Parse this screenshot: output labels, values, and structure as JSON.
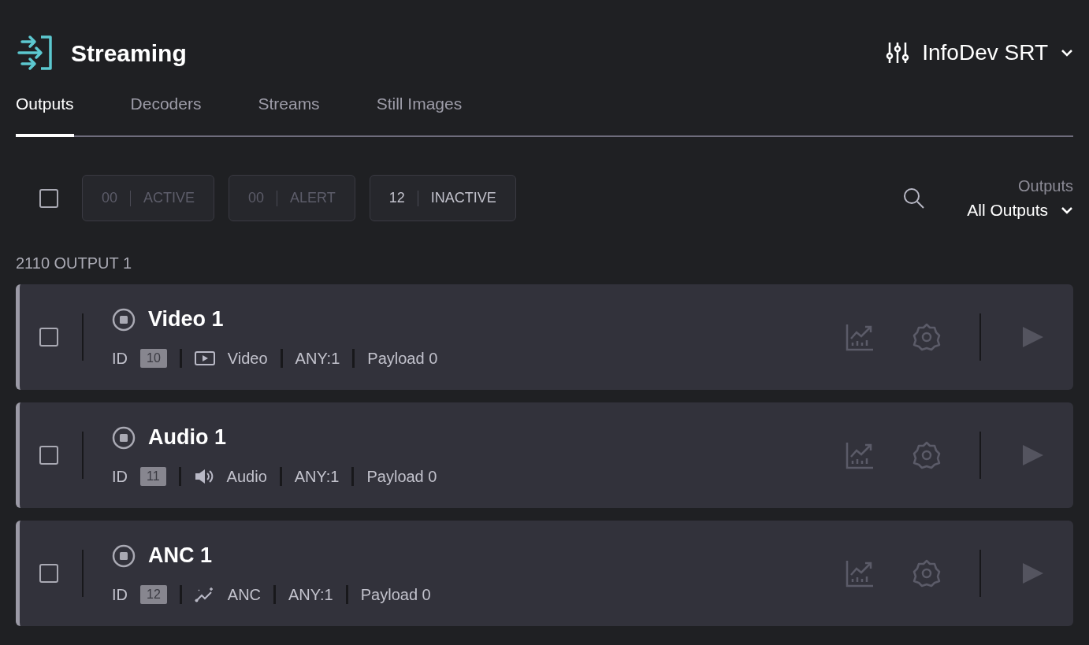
{
  "header": {
    "title": "Streaming",
    "device": "InfoDev SRT"
  },
  "tabs": [
    {
      "label": "Outputs",
      "selected": true
    },
    {
      "label": "Decoders",
      "selected": false
    },
    {
      "label": "Streams",
      "selected": false
    },
    {
      "label": "Still Images",
      "selected": false
    }
  ],
  "select_all": {
    "checked": false
  },
  "filters": [
    {
      "count": "00",
      "label": "ACTIVE",
      "disabled": true
    },
    {
      "count": "00",
      "label": "ALERT",
      "disabled": true
    },
    {
      "count": "12",
      "label": "INACTIVE",
      "disabled": false
    }
  ],
  "output_filter": {
    "label": "Outputs",
    "value": "All Outputs"
  },
  "group": {
    "title": "2110 OUTPUT 1"
  },
  "outputs": [
    {
      "name": "Video 1",
      "id_label": "ID",
      "id": "10",
      "kind": "video",
      "type": "Video",
      "format": "ANY:1",
      "payload": "Payload 0",
      "checked": false
    },
    {
      "name": "Audio 1",
      "id_label": "ID",
      "id": "11",
      "kind": "audio",
      "type": "Audio",
      "format": "ANY:1",
      "payload": "Payload 0",
      "checked": false
    },
    {
      "name": "ANC 1",
      "id_label": "ID",
      "id": "12",
      "kind": "anc",
      "type": "ANC",
      "format": "ANY:1",
      "payload": "Payload 0",
      "checked": false
    }
  ]
}
